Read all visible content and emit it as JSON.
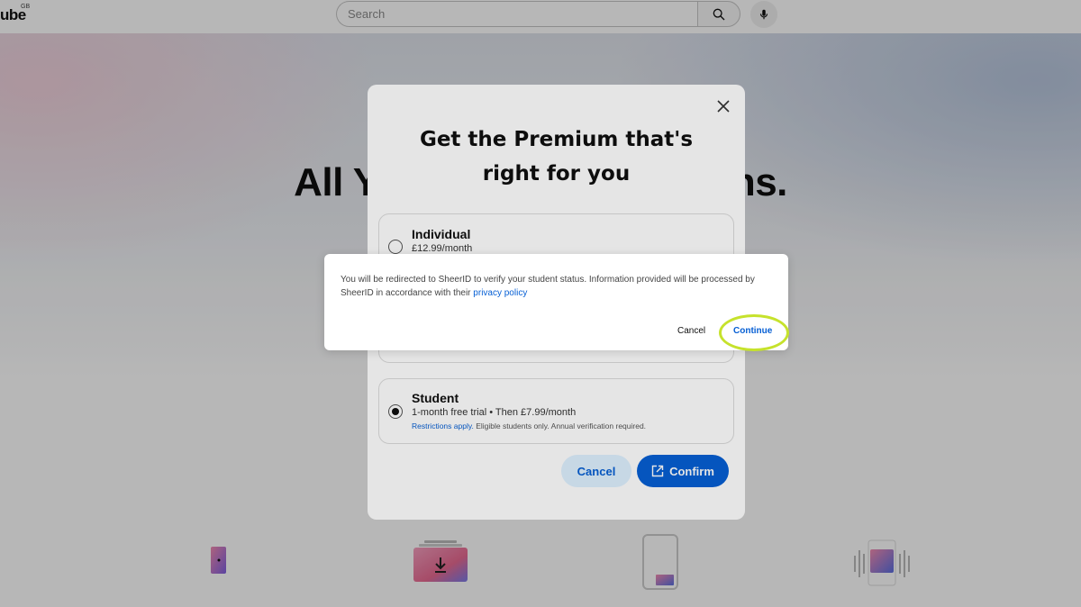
{
  "header": {
    "logo_text": "ube",
    "logo_region": "GB",
    "search_placeholder": "Search",
    "icons": [
      "search-icon",
      "mic-icon"
    ]
  },
  "hero": {
    "title": "All Yo",
    "title_tail": "ions."
  },
  "premium_dialog": {
    "title": "Get the Premium that's right for you",
    "plans": [
      {
        "name": "Individual",
        "price": "£12.99/month",
        "selected": false
      },
      {
        "name": "Student",
        "price": "1-month free trial • Then £7.99/month",
        "note_link": "Restrictions apply.",
        "note": " Eligible students only. Annual verification required.",
        "selected": true
      }
    ],
    "cancel_label": "Cancel",
    "confirm_label": "Confirm",
    "icons": [
      "close-icon",
      "external-link-icon"
    ]
  },
  "redirect_dialog": {
    "message": "You will be redirected to SheerID to verify your student status. Information provided will be processed by SheerID in accordance with their ",
    "link_text": "privacy policy",
    "cancel_label": "Cancel",
    "continue_label": "Continue",
    "highlight_color": "#c6e22c"
  },
  "colors": {
    "accent": "#065fd4",
    "secondary_button_bg": "#def1ff"
  }
}
